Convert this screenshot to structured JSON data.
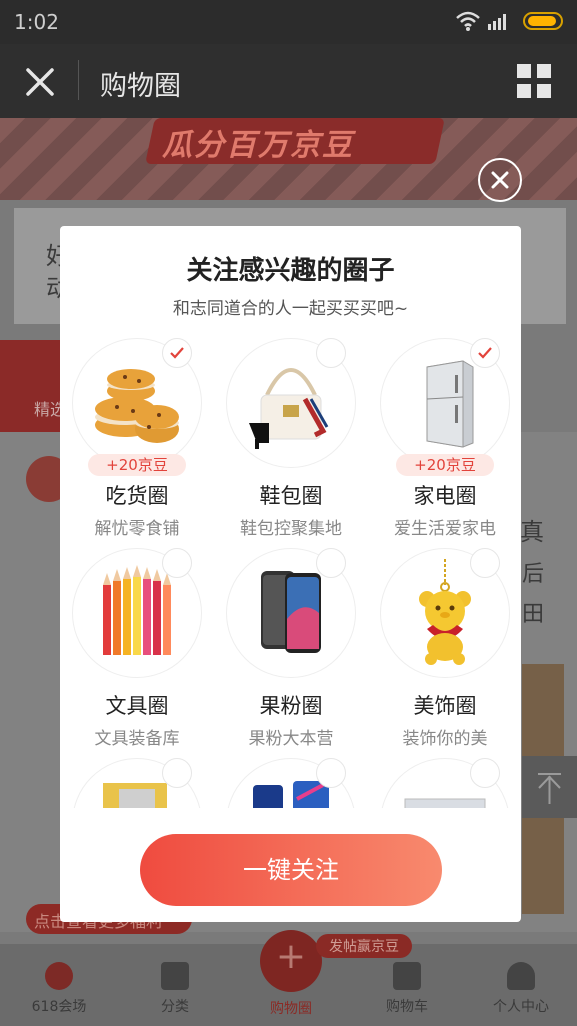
{
  "status_bar": {
    "time": "1:02"
  },
  "header": {
    "title": "购物圈"
  },
  "background": {
    "banner_text": "瓜分百万京豆",
    "card_text_1": "好",
    "card_text_2": "动",
    "tab_label": "精选",
    "right_text_1": "真",
    "right_text_2": "后",
    "right_text_3": "田",
    "pill_text": "点击查看更多福利"
  },
  "modal": {
    "title": "关注感兴趣的圈子",
    "subtitle": "和志同道合的人一起买买买吧~",
    "circles": [
      {
        "name": "吃货圈",
        "desc": "解忧零食铺",
        "reward": "+20京豆",
        "selected": true
      },
      {
        "name": "鞋包圈",
        "desc": "鞋包控聚集地",
        "reward": "",
        "selected": false
      },
      {
        "name": "家电圈",
        "desc": "爱生活爱家电",
        "reward": "+20京豆",
        "selected": true
      },
      {
        "name": "文具圈",
        "desc": "文具装备库",
        "reward": "",
        "selected": false
      },
      {
        "name": "果粉圈",
        "desc": "果粉大本营",
        "reward": "",
        "selected": false
      },
      {
        "name": "美饰圈",
        "desc": "装饰你的美",
        "reward": "",
        "selected": false
      }
    ],
    "follow_button": "一键关注"
  },
  "bottom_nav": {
    "items": [
      {
        "label": "618会场"
      },
      {
        "label": "分类"
      },
      {
        "label": "购物圈"
      },
      {
        "label": "购物车"
      },
      {
        "label": "个人中心"
      }
    ],
    "badge": "发帖赢京豆"
  },
  "colors": {
    "accent": "#ef4b3f",
    "reward_bg": "#fde8e4",
    "reward_text": "#e2433b"
  }
}
